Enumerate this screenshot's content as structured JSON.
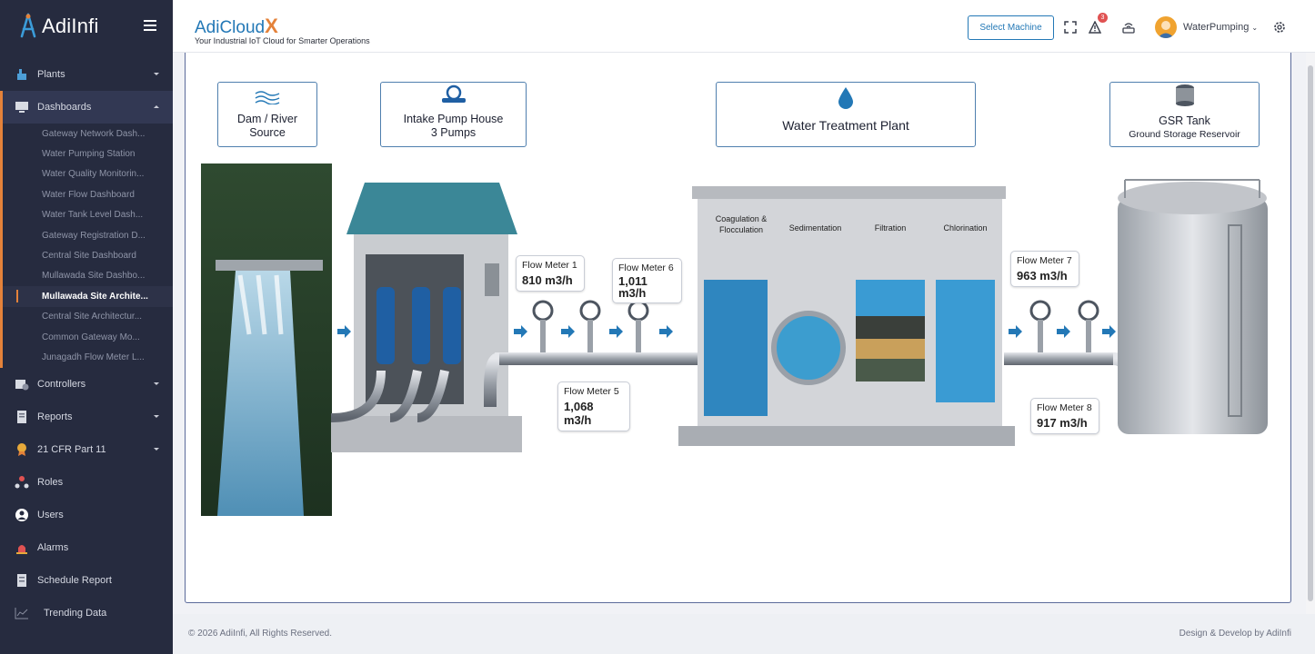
{
  "brand": {
    "name": "AdiInfi"
  },
  "sidebar": {
    "items": [
      {
        "label": "Plants",
        "icon": "plant-icon",
        "expandable": true
      },
      {
        "label": "Dashboards",
        "icon": "dashboard-icon",
        "expandable": true,
        "active": true
      },
      {
        "label": "Controllers",
        "icon": "controller-icon",
        "expandable": true
      },
      {
        "label": "Reports",
        "icon": "report-icon",
        "expandable": true
      },
      {
        "label": "21 CFR Part 11",
        "icon": "badge-icon",
        "expandable": true
      },
      {
        "label": "Roles",
        "icon": "roles-icon",
        "expandable": false
      },
      {
        "label": "Users",
        "icon": "user-icon",
        "expandable": false
      },
      {
        "label": "Alarms",
        "icon": "alarm-icon",
        "expandable": false
      },
      {
        "label": "Schedule Report",
        "icon": "schedule-icon",
        "expandable": false
      },
      {
        "label": "Trending Data",
        "icon": "trend-icon",
        "expandable": false
      }
    ],
    "dashboards": [
      "Gateway Network Dash...",
      "Water Pumping Station",
      "Water Quality Monitorin...",
      "Water Flow Dashboard",
      "Water Tank Level Dash...",
      "Gateway Registration D...",
      "Central Site Dashboard",
      "Mullawada Site Dashbo...",
      "Mullawada Site Archite...",
      "Central Site Architectur...",
      "Common Gateway Mo...",
      "Junagadh Flow Meter L..."
    ],
    "current_dashboard": "Mullawada Site Archite..."
  },
  "header": {
    "product": "AdiCloud",
    "product_mark": "X",
    "tagline": "Your Industrial IoT Cloud for Smarter Operations",
    "select_machine": "Select Machine",
    "alerts_count": "3",
    "user": "WaterPumping"
  },
  "diagram": {
    "source": {
      "line1": "Dam / River",
      "line2": "Source"
    },
    "intake": {
      "line1": "Intake Pump House",
      "line2": "3 Pumps"
    },
    "wtp": {
      "title": "Water Treatment Plant"
    },
    "gsr": {
      "line1": "GSR Tank",
      "line2": "Ground Storage Reservoir"
    },
    "stages": [
      "Coagulation &",
      "Flocculation",
      "Sedimentation",
      "Filtration",
      "Chlorination"
    ],
    "meters": {
      "fm1": {
        "name": "Flow Meter 1",
        "value": "810 m3/h"
      },
      "fm5": {
        "name": "Flow Meter 5",
        "value": "1,068 m3/h"
      },
      "fm6": {
        "name": "Flow Meter 6",
        "value": "1,011 m3/h"
      },
      "fm7": {
        "name": "Flow Meter 7",
        "value": "963 m3/h"
      },
      "fm8": {
        "name": "Flow Meter 8",
        "value": "917 m3/h"
      }
    }
  },
  "footer": {
    "copyright": "© 2026 AdiInfi, All Rights Reserved.",
    "credit": "Design & Develop by AdiInfi"
  },
  "colors": {
    "sidebar": "#262b3f",
    "accent": "#e4823a",
    "primary": "#2378b6"
  }
}
